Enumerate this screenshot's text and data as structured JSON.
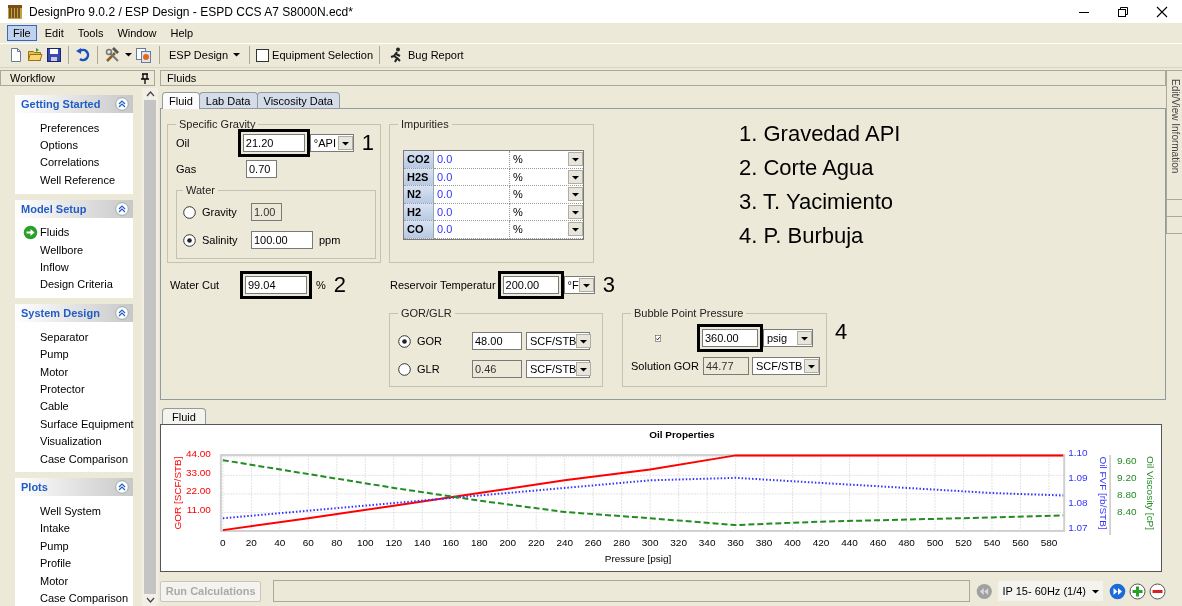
{
  "window": {
    "title": "DesignPro 9.0.2 / ESP Design - ESPD CCS A7 S8000N.ecd*"
  },
  "menu": [
    {
      "label": "File",
      "selected": true
    },
    {
      "label": "Edit",
      "selected": false
    },
    {
      "label": "Tools",
      "selected": false
    },
    {
      "label": "Window",
      "selected": false
    },
    {
      "label": "Help",
      "selected": false
    }
  ],
  "toolbar": {
    "mode": "ESP Design",
    "equipment_selection": {
      "label": "Equipment Selection",
      "checked": false
    },
    "bug_report": "Bug Report"
  },
  "workflow": {
    "title": "Workflow",
    "groups": [
      {
        "title": "Getting Started",
        "expanded": true,
        "items": [
          {
            "label": "Preferences",
            "current": false
          },
          {
            "label": "Options",
            "current": false
          },
          {
            "label": "Correlations",
            "current": false
          },
          {
            "label": "Well Reference",
            "current": false
          }
        ]
      },
      {
        "title": "Model Setup",
        "expanded": true,
        "items": [
          {
            "label": "Fluids",
            "current": true
          },
          {
            "label": "Wellbore",
            "current": false
          },
          {
            "label": "Inflow",
            "current": false
          },
          {
            "label": "Design Criteria",
            "current": false
          }
        ]
      },
      {
        "title": "System Design",
        "expanded": true,
        "items": [
          {
            "label": "Separator",
            "current": false
          },
          {
            "label": "Pump",
            "current": false
          },
          {
            "label": "Motor",
            "current": false
          },
          {
            "label": "Protector",
            "current": false
          },
          {
            "label": "Cable",
            "current": false
          },
          {
            "label": "Surface Equipment",
            "current": false
          },
          {
            "label": "Visualization",
            "current": false
          },
          {
            "label": "Case Comparison",
            "current": false
          }
        ]
      },
      {
        "title": "Plots",
        "expanded": true,
        "items": [
          {
            "label": "Well System",
            "current": false
          },
          {
            "label": "Intake",
            "current": false
          },
          {
            "label": "Pump",
            "current": false
          },
          {
            "label": "Profile",
            "current": false
          },
          {
            "label": "Motor",
            "current": false
          },
          {
            "label": "Case Comparison",
            "current": false
          }
        ]
      }
    ]
  },
  "document": {
    "title": "Fluids",
    "tabs": [
      {
        "label": "Fluid",
        "selected": true
      },
      {
        "label": "Lab Data",
        "selected": false
      },
      {
        "label": "Viscosity Data",
        "selected": false
      }
    ],
    "specific_gravity": {
      "title": "Specific Gravity",
      "oil": {
        "label": "Oil",
        "value": "21.20",
        "unit": "°API",
        "marker": "1"
      },
      "gas": {
        "label": "Gas",
        "value": "0.70"
      },
      "water": {
        "title": "Water",
        "options": [
          {
            "label": "Gravity",
            "value": "1.00",
            "selected": false
          },
          {
            "label": "Salinity",
            "value": "100.00",
            "unit": "ppm",
            "selected": true
          }
        ]
      }
    },
    "impurities": {
      "title": "Impurities",
      "rows": [
        {
          "name": "CO2",
          "value": "0.0",
          "unit": "%"
        },
        {
          "name": "H2S",
          "value": "0.0",
          "unit": "%"
        },
        {
          "name": "N2",
          "value": "0.0",
          "unit": "%"
        },
        {
          "name": "H2",
          "value": "0.0",
          "unit": "%"
        },
        {
          "name": "CO",
          "value": "0.0",
          "unit": "%"
        }
      ]
    },
    "water_cut": {
      "label": "Water Cut",
      "value": "99.04",
      "unit": "%",
      "marker": "2"
    },
    "reservoir_temperature": {
      "label": "Reservoir Temperatur",
      "value": "200.00",
      "unit": "°F",
      "marker": "3"
    },
    "gor_glr": {
      "title": "GOR/GLR",
      "options": [
        {
          "label": "GOR",
          "value": "48.00",
          "unit": "SCF/STB",
          "selected": true
        },
        {
          "label": "GLR",
          "value": "0.46",
          "unit": "SCF/STB",
          "selected": false
        }
      ]
    },
    "bubble_point": {
      "title": "Bubble Point Pressure",
      "checked": true,
      "value": "360.00",
      "unit": "psig",
      "marker": "4",
      "solution_gor": {
        "label": "Solution GOR",
        "value": "44.77",
        "unit": "SCF/STB",
        "disabled": true
      }
    },
    "notes": [
      "1. Gravedad API",
      "2. Corte Agua",
      "3. T. Yacimiento",
      "4. P. Burbuja"
    ],
    "chart_tabs": [
      {
        "label": "Fluid",
        "selected": true
      }
    ],
    "chart_data": {
      "type": "line",
      "title": "Oil Properties",
      "xlabel": "Pressure [psig]",
      "ylabel": "GOR [SCF/STB]",
      "x": [
        0,
        60,
        120,
        180,
        240,
        300,
        360,
        420,
        480,
        540,
        590
      ],
      "xlim": [
        0,
        590
      ],
      "xticks": [
        0,
        20,
        40,
        60,
        80,
        100,
        120,
        140,
        160,
        180,
        200,
        220,
        240,
        260,
        280,
        300,
        320,
        340,
        360,
        380,
        400,
        420,
        440,
        460,
        480,
        500,
        520,
        540,
        560,
        580
      ],
      "ylim": [
        0,
        45
      ],
      "yticks": [
        {
          "value": 11,
          "label": "11.00"
        },
        {
          "value": 22,
          "label": "22.00"
        },
        {
          "value": 33,
          "label": "33.00"
        },
        {
          "value": 44,
          "label": "44.00"
        }
      ],
      "y2label": "Oil FVF [rb/STB]",
      "y2lim": [
        1.07,
        1.1
      ],
      "y2ticks": [
        {
          "value": 1.07,
          "label": "1.07"
        },
        {
          "value": 1.08,
          "label": "1.08"
        },
        {
          "value": 1.09,
          "label": "1.09"
        },
        {
          "value": 1.1,
          "label": "1.10"
        }
      ],
      "y3label": "Oil Viscosity [cP]",
      "y3lim": [
        8.0,
        9.8
      ],
      "y3ticks": [
        {
          "value": 8.4,
          "label": "8.40"
        },
        {
          "value": 8.8,
          "label": "8.80"
        },
        {
          "value": 9.2,
          "label": "9.20"
        },
        {
          "value": 9.6,
          "label": "9.60"
        }
      ],
      "series": [
        {
          "color": "#ff0000",
          "line_style": "solid",
          "values": [
            0.5,
            7.5,
            15,
            22.5,
            30,
            36.5,
            44.8,
            44.8,
            44.8,
            44.8,
            44.8
          ]
        },
        {
          "color": "#3333ff",
          "axis": "y2",
          "line_style": "dotted",
          "values": [
            1.075,
            1.078,
            1.081,
            1.084,
            1.087,
            1.09,
            1.091,
            1.089,
            1.087,
            1.085,
            1.084
          ]
        },
        {
          "color": "#228b22",
          "axis": "y3",
          "line_style": "dashed",
          "values": [
            9.68,
            9.35,
            9.02,
            8.72,
            8.45,
            8.3,
            8.14,
            8.22,
            8.27,
            8.32,
            8.37
          ]
        }
      ],
      "grid": true
    },
    "run_button": {
      "label": "Run Calculations",
      "disabled": true
    },
    "case_selector": "IP 15- 60Hz (1/4)",
    "previous_case": {
      "disabled": true
    },
    "next_case": {
      "disabled": false
    }
  },
  "side_tab": "Edit/View Information"
}
